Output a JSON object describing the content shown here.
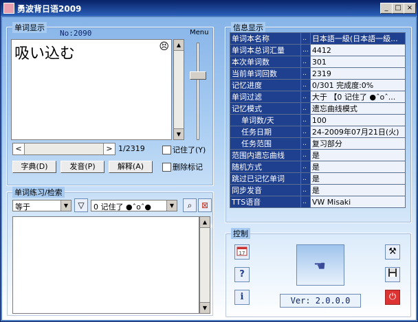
{
  "window": {
    "title": "勇波背日语2009",
    "min_label": "_",
    "max_label": "□",
    "close_label": "×"
  },
  "word_panel": {
    "group_title": "单词显示",
    "word_number": "No:2090",
    "menu_label": "Menu",
    "word": "吸い込む",
    "emoticon": "😣",
    "position": "1/2319",
    "remember_label": "记住了(Y)",
    "delete_mark_label": "删除标记",
    "dict_button": "字典(D)",
    "pronounce_button": "发音(P)",
    "explain_button": "解释(A)",
    "slider_level_percent": 45
  },
  "practice_panel": {
    "group_title": "单词练习/检索",
    "mode_value": "等于",
    "filter_value": "0 记住了 ●ˆoˆ●",
    "filter_icon": "funnel-icon",
    "search_icon": "magnifier-icon",
    "clear_icon": "clear-icon"
  },
  "info_panel": {
    "group_title": "信息显示",
    "rows": [
      {
        "key": "单词本名称",
        "dots": "..",
        "value": "日本語一級(日本語一級...",
        "highlight": true
      },
      {
        "key": "单词本总词汇量",
        "dots": "...",
        "value": "4412"
      },
      {
        "key": "本次单词数",
        "dots": "..",
        "value": "301"
      },
      {
        "key": "当前单词回数",
        "dots": "..",
        "value": "2319"
      },
      {
        "key": "记忆进度",
        "dots": "..",
        "value": "0/301      完成度:0%"
      },
      {
        "key": "单词过滤",
        "dots": "..",
        "value": "大于 【0 记住了 ●ˆoˆ..."
      },
      {
        "key": "记忆模式",
        "dots": "..",
        "value": "遗忘曲线模式"
      },
      {
        "key": "单词数/天",
        "dots": "..",
        "value": "100",
        "sub": true
      },
      {
        "key": "任务日期",
        "dots": "..",
        "value": "24-2009年07月21日(火)",
        "sub": true
      },
      {
        "key": "任务范围",
        "dots": "..",
        "value": "复习部分",
        "sub": true
      },
      {
        "key": "范围内遗忘曲线",
        "dots": "..",
        "value": "是"
      },
      {
        "key": "随机方式",
        "dots": "..",
        "value": "是"
      },
      {
        "key": "跳过已记忆单词",
        "dots": "..",
        "value": "是"
      },
      {
        "key": "同步发音",
        "dots": "..",
        "value": "是"
      },
      {
        "key": "TTS语音",
        "dots": "..",
        "value": "VW Misaki"
      }
    ]
  },
  "control_panel": {
    "group_title": "控制",
    "calendar_icon": "calendar-icon",
    "help_icon": "question-icon",
    "info_icon": "info-icon",
    "tools_icon": "tools-icon",
    "save_icon": "floppy-disk-icon",
    "power_icon": "power-icon",
    "hand_icon": "hand-cursor-icon",
    "version": "Ver: 2.0.0.0"
  }
}
